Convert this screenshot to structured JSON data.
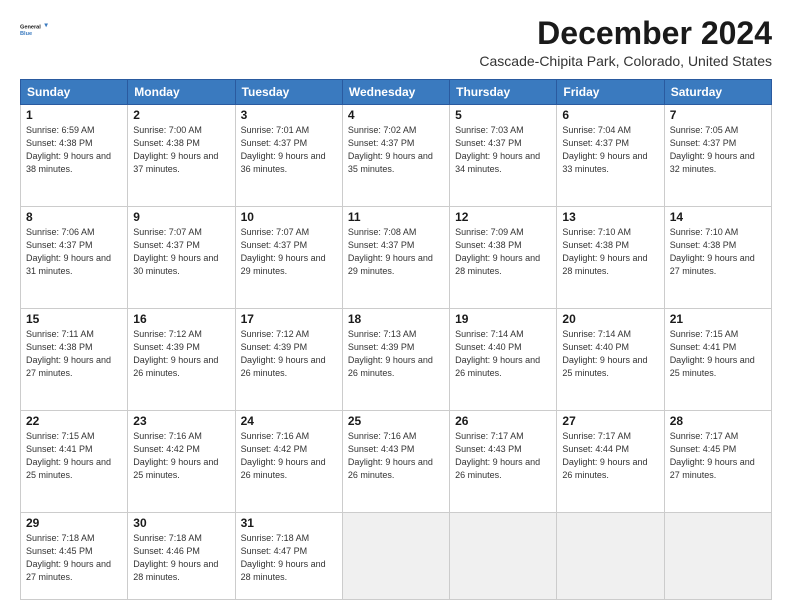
{
  "logo": {
    "text_general": "General",
    "text_blue": "Blue"
  },
  "header": {
    "month": "December 2024",
    "location": "Cascade-Chipita Park, Colorado, United States"
  },
  "weekdays": [
    "Sunday",
    "Monday",
    "Tuesday",
    "Wednesday",
    "Thursday",
    "Friday",
    "Saturday"
  ],
  "weeks": [
    [
      {
        "day": "1",
        "sunrise": "6:59 AM",
        "sunset": "4:38 PM",
        "daylight": "9 hours and 38 minutes."
      },
      {
        "day": "2",
        "sunrise": "7:00 AM",
        "sunset": "4:38 PM",
        "daylight": "9 hours and 37 minutes."
      },
      {
        "day": "3",
        "sunrise": "7:01 AM",
        "sunset": "4:37 PM",
        "daylight": "9 hours and 36 minutes."
      },
      {
        "day": "4",
        "sunrise": "7:02 AM",
        "sunset": "4:37 PM",
        "daylight": "9 hours and 35 minutes."
      },
      {
        "day": "5",
        "sunrise": "7:03 AM",
        "sunset": "4:37 PM",
        "daylight": "9 hours and 34 minutes."
      },
      {
        "day": "6",
        "sunrise": "7:04 AM",
        "sunset": "4:37 PM",
        "daylight": "9 hours and 33 minutes."
      },
      {
        "day": "7",
        "sunrise": "7:05 AM",
        "sunset": "4:37 PM",
        "daylight": "9 hours and 32 minutes."
      }
    ],
    [
      {
        "day": "8",
        "sunrise": "7:06 AM",
        "sunset": "4:37 PM",
        "daylight": "9 hours and 31 minutes."
      },
      {
        "day": "9",
        "sunrise": "7:07 AM",
        "sunset": "4:37 PM",
        "daylight": "9 hours and 30 minutes."
      },
      {
        "day": "10",
        "sunrise": "7:07 AM",
        "sunset": "4:37 PM",
        "daylight": "9 hours and 29 minutes."
      },
      {
        "day": "11",
        "sunrise": "7:08 AM",
        "sunset": "4:37 PM",
        "daylight": "9 hours and 29 minutes."
      },
      {
        "day": "12",
        "sunrise": "7:09 AM",
        "sunset": "4:38 PM",
        "daylight": "9 hours and 28 minutes."
      },
      {
        "day": "13",
        "sunrise": "7:10 AM",
        "sunset": "4:38 PM",
        "daylight": "9 hours and 28 minutes."
      },
      {
        "day": "14",
        "sunrise": "7:10 AM",
        "sunset": "4:38 PM",
        "daylight": "9 hours and 27 minutes."
      }
    ],
    [
      {
        "day": "15",
        "sunrise": "7:11 AM",
        "sunset": "4:38 PM",
        "daylight": "9 hours and 27 minutes."
      },
      {
        "day": "16",
        "sunrise": "7:12 AM",
        "sunset": "4:39 PM",
        "daylight": "9 hours and 26 minutes."
      },
      {
        "day": "17",
        "sunrise": "7:12 AM",
        "sunset": "4:39 PM",
        "daylight": "9 hours and 26 minutes."
      },
      {
        "day": "18",
        "sunrise": "7:13 AM",
        "sunset": "4:39 PM",
        "daylight": "9 hours and 26 minutes."
      },
      {
        "day": "19",
        "sunrise": "7:14 AM",
        "sunset": "4:40 PM",
        "daylight": "9 hours and 26 minutes."
      },
      {
        "day": "20",
        "sunrise": "7:14 AM",
        "sunset": "4:40 PM",
        "daylight": "9 hours and 25 minutes."
      },
      {
        "day": "21",
        "sunrise": "7:15 AM",
        "sunset": "4:41 PM",
        "daylight": "9 hours and 25 minutes."
      }
    ],
    [
      {
        "day": "22",
        "sunrise": "7:15 AM",
        "sunset": "4:41 PM",
        "daylight": "9 hours and 25 minutes."
      },
      {
        "day": "23",
        "sunrise": "7:16 AM",
        "sunset": "4:42 PM",
        "daylight": "9 hours and 25 minutes."
      },
      {
        "day": "24",
        "sunrise": "7:16 AM",
        "sunset": "4:42 PM",
        "daylight": "9 hours and 26 minutes."
      },
      {
        "day": "25",
        "sunrise": "7:16 AM",
        "sunset": "4:43 PM",
        "daylight": "9 hours and 26 minutes."
      },
      {
        "day": "26",
        "sunrise": "7:17 AM",
        "sunset": "4:43 PM",
        "daylight": "9 hours and 26 minutes."
      },
      {
        "day": "27",
        "sunrise": "7:17 AM",
        "sunset": "4:44 PM",
        "daylight": "9 hours and 26 minutes."
      },
      {
        "day": "28",
        "sunrise": "7:17 AM",
        "sunset": "4:45 PM",
        "daylight": "9 hours and 27 minutes."
      }
    ],
    [
      {
        "day": "29",
        "sunrise": "7:18 AM",
        "sunset": "4:45 PM",
        "daylight": "9 hours and 27 minutes."
      },
      {
        "day": "30",
        "sunrise": "7:18 AM",
        "sunset": "4:46 PM",
        "daylight": "9 hours and 28 minutes."
      },
      {
        "day": "31",
        "sunrise": "7:18 AM",
        "sunset": "4:47 PM",
        "daylight": "9 hours and 28 minutes."
      },
      null,
      null,
      null,
      null
    ]
  ]
}
